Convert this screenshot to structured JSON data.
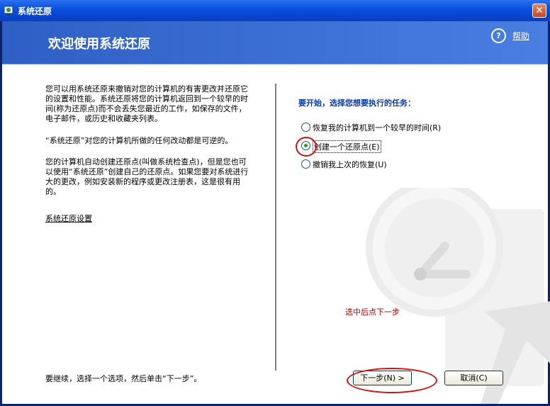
{
  "window": {
    "title": "系统还原",
    "close_glyph": "✕"
  },
  "header": {
    "title": "欢迎使用系统还原",
    "help_link": "帮助",
    "help_glyph": "?"
  },
  "left": {
    "paragraphs": [
      "您可以用系统还原来撤销对您的计算机的有害更改并还原它的设置和性能。系统还原将您的计算机返回到一个较早的时间(称为还原点)而不会丢失您最近的工作，如保存的文件，电子邮件，或历史和收藏夹列表。",
      "“系统还原”对您的计算机所做的任何改动都是可逆的。",
      "您的计算机自动创建还原点(叫做系统检查点)，但是您也可以使用“系统还原”创建自己的还原点。如果您要对系统进行大的更改，例如安装新的程序或更改注册表，这是很有用的。"
    ],
    "settings_link": "系统还原设置"
  },
  "tasks": {
    "heading": "要开始，选择您想要执行的任务：",
    "options": [
      {
        "label": "恢复我的计算机到一个较早的时间(R)",
        "checked": false
      },
      {
        "label": "创建一个还原点(E)",
        "checked": true
      },
      {
        "label": "撤销我上次的恢复(U)",
        "checked": false
      }
    ]
  },
  "annotation": "选中后点下一步",
  "footer": {
    "instruction": "要继续，选择一个选项，然后单击“下一步”。",
    "next_button": "下一步(N) >",
    "cancel_button": "取消(C)"
  },
  "colors": {
    "accent": "#2e5fc4",
    "annotation": "#d01010"
  }
}
